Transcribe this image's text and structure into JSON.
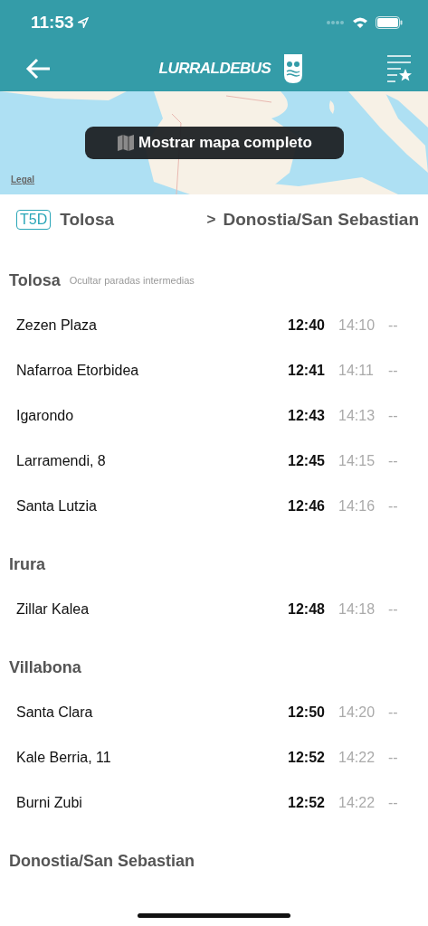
{
  "status_bar": {
    "time": "11:53"
  },
  "nav": {
    "logo": "LURRALDEBUS"
  },
  "map": {
    "kind": "picture",
    "button": "Mostrar mapa completo",
    "legal": "Legal"
  },
  "route": {
    "line": "T5D",
    "origin": "Tolosa",
    "arrow": ">",
    "destination": "Donostia/San Sebastian"
  },
  "groups": [
    {
      "town": "Tolosa",
      "action": "Ocultar paradas intermedias",
      "stops": [
        {
          "name": "Zezen Plaza",
          "times": [
            "12:40",
            "14:10",
            "--"
          ]
        },
        {
          "name": "Nafarroa Etorbidea",
          "times": [
            "12:41",
            "14:11",
            "--"
          ]
        },
        {
          "name": "Igarondo",
          "times": [
            "12:43",
            "14:13",
            "--"
          ]
        },
        {
          "name": "Larramendi, 8",
          "times": [
            "12:45",
            "14:15",
            "--"
          ]
        },
        {
          "name": "Santa Lutzia",
          "times": [
            "12:46",
            "14:16",
            "--"
          ]
        }
      ]
    },
    {
      "town": "Irura",
      "stops": [
        {
          "name": "Zillar Kalea",
          "times": [
            "12:48",
            "14:18",
            "--"
          ]
        }
      ]
    },
    {
      "town": "Villabona",
      "stops": [
        {
          "name": "Santa Clara",
          "times": [
            "12:50",
            "14:20",
            "--"
          ]
        },
        {
          "name": "Kale Berria, 11",
          "times": [
            "12:52",
            "14:22",
            "--"
          ]
        },
        {
          "name": "Burni Zubi",
          "times": [
            "12:52",
            "14:22",
            "--"
          ]
        }
      ]
    },
    {
      "town": "Donostia/San Sebastian"
    }
  ]
}
